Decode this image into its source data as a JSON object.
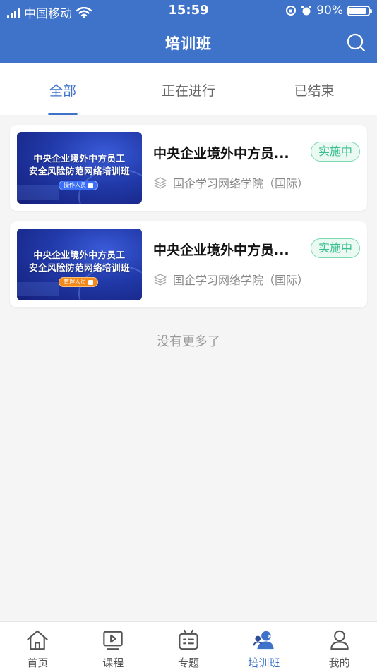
{
  "status_bar": {
    "carrier": "中国移动",
    "time": "15:59",
    "battery": "90%",
    "battery_level": 0.9
  },
  "header": {
    "title": "培训班",
    "search_icon": "search-icon"
  },
  "tabs": [
    {
      "label": "全部",
      "active": true
    },
    {
      "label": "正在进行",
      "active": false
    },
    {
      "label": "已结束",
      "active": false
    }
  ],
  "courses": [
    {
      "thumb_line1": "中央企业境外中方员工",
      "thumb_line2": "安全风险防范网络培训班",
      "thumb_badge": "操作人员",
      "title": "中央企业境外中方员...",
      "status": "实施中",
      "org": "国企学习网络学院（国际）"
    },
    {
      "thumb_line1": "中央企业境外中方员工",
      "thumb_line2": "安全风险防范网络培训班",
      "thumb_badge": "管理人员",
      "title": "中央企业境外中方员...",
      "status": "实施中",
      "org": "国企学习网络学院（国际）"
    }
  ],
  "no_more": "没有更多了",
  "tabbar": [
    {
      "label": "首页",
      "icon": "home-icon",
      "active": false
    },
    {
      "label": "课程",
      "icon": "play-icon",
      "active": false
    },
    {
      "label": "专题",
      "icon": "topic-icon",
      "active": false
    },
    {
      "label": "培训班",
      "icon": "training-icon",
      "active": true
    },
    {
      "label": "我的",
      "icon": "profile-icon",
      "active": false
    }
  ],
  "colors": {
    "brand": "#3f73c9",
    "status_green": "#3cbf8e",
    "background": "#f5f5f6"
  }
}
